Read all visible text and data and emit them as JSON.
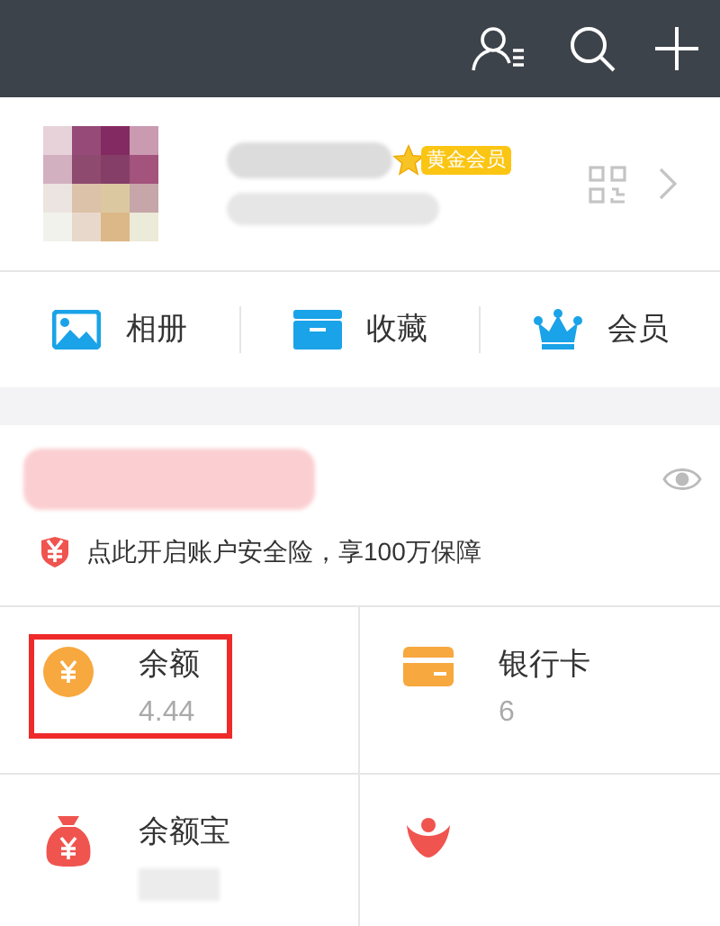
{
  "profile": {
    "badge": "黄金会员"
  },
  "shortcuts": [
    {
      "kind": "photo",
      "label": "相册"
    },
    {
      "kind": "box",
      "label": "收藏"
    },
    {
      "kind": "crown",
      "label": "会员"
    }
  ],
  "account": {
    "insurance_text": "点此开启账户安全险，享100万保障"
  },
  "grid": [
    {
      "kind": "coin",
      "label": "余额",
      "value": "4.44",
      "highlighted": true
    },
    {
      "kind": "card",
      "label": "银行卡",
      "value": "6",
      "highlighted": false
    },
    {
      "kind": "bag",
      "label": "余额宝",
      "highlighted": false
    },
    {
      "kind": "person",
      "highlighted": false
    }
  ]
}
